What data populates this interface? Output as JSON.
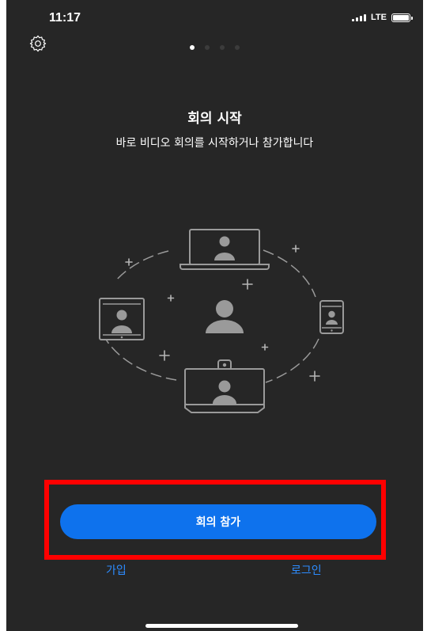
{
  "status_bar": {
    "time": "11:17",
    "network": "LTE"
  },
  "pager": {
    "total": 4,
    "active_index": 0
  },
  "onboarding": {
    "title": "회의 시작",
    "subtitle": "바로 비디오 회의를 시작하거나 참가합니다"
  },
  "actions": {
    "join_label": "회의 참가",
    "signup_label": "가입",
    "login_label": "로그인"
  },
  "colors": {
    "background": "#262626",
    "primary_button": "#0e72ed",
    "link": "#2d8cff",
    "highlight_box": "#ff0000"
  },
  "icons": [
    "gear-icon",
    "signal-icon",
    "battery-icon"
  ]
}
